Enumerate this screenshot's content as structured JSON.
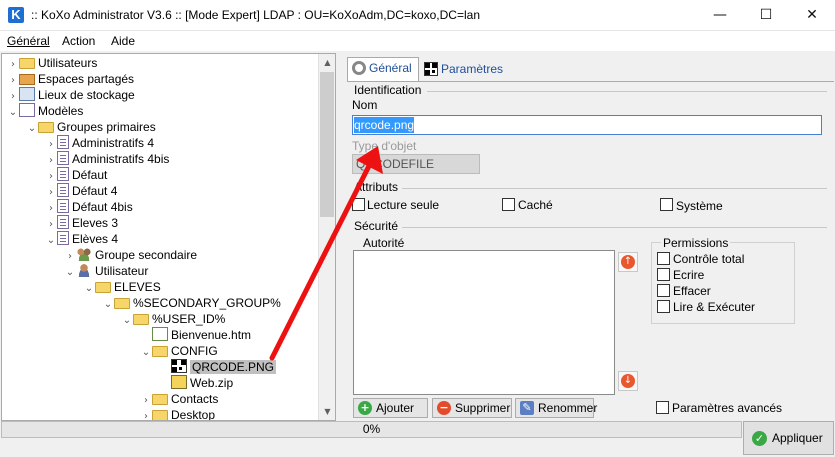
{
  "window": {
    "title": ":: KoXo Administrator V3.6 :: [Mode Expert] LDAP : OU=KoXoAdm,DC=koxo,DC=lan",
    "logo_letter": "K",
    "minimize": "—",
    "maximize": "☐",
    "close": "✕"
  },
  "menu": {
    "general": "Général",
    "action": "Action",
    "aide": "Aide"
  },
  "tree": {
    "items": [
      {
        "label": "Utilisateurs",
        "icon": "users-folder-icon"
      },
      {
        "label": "Espaces partagés",
        "icon": "shared-space-icon"
      },
      {
        "label": "Lieux de stockage",
        "icon": "storage-icon"
      },
      {
        "label": "Modèles",
        "icon": "models-icon"
      },
      {
        "label": "Groupes primaires",
        "icon": "folder-open-icon"
      },
      {
        "label": "Administratifs 4",
        "icon": "template-icon"
      },
      {
        "label": "Administratifs 4bis",
        "icon": "template-icon"
      },
      {
        "label": "Défaut",
        "icon": "template-icon"
      },
      {
        "label": "Défaut 4",
        "icon": "template-icon"
      },
      {
        "label": "Défaut 4bis",
        "icon": "template-icon"
      },
      {
        "label": "Eleves 3",
        "icon": "template-icon"
      },
      {
        "label": "Elèves 4",
        "icon": "template-icon"
      },
      {
        "label": "Groupe secondaire",
        "icon": "group-icon"
      },
      {
        "label": "Utilisateur",
        "icon": "user-icon"
      },
      {
        "label": "ELEVES",
        "icon": "folder-icon"
      },
      {
        "label": "%SECONDARY_GROUP%",
        "icon": "folder-icon"
      },
      {
        "label": "%USER_ID%",
        "icon": "folder-icon"
      },
      {
        "label": "Bienvenue.htm",
        "icon": "html-file-icon"
      },
      {
        "label": "CONFIG",
        "icon": "folder-icon"
      },
      {
        "label": "QRCODE.PNG",
        "icon": "qrcode-file-icon"
      },
      {
        "label": "Web.zip",
        "icon": "zip-file-icon"
      },
      {
        "label": "Contacts",
        "icon": "folder-icon"
      },
      {
        "label": "Desktop",
        "icon": "folder-icon"
      }
    ]
  },
  "tabs": {
    "general": "Général",
    "parametres": "Paramètres"
  },
  "general": {
    "identification": "Identification",
    "nom_label": "Nom",
    "nom_value": "qrcode.png",
    "type_label": "Type d'objet",
    "type_value": "QRCODEFILE",
    "attributs": "Attributs",
    "lecture_seule": "Lecture seule",
    "cache": "Caché",
    "systeme": "Système",
    "securite": "Sécurité",
    "autorite": "Autorité",
    "permissions": "Permissions",
    "controle_total": "Contrôle total",
    "ecrire": "Ecrire",
    "effacer": "Effacer",
    "lire_executer": "Lire & Exécuter",
    "parametres_avances": "Paramètres avancés",
    "ajouter": "Ajouter",
    "supprimer": "Supprimer",
    "renommer": "Renommer"
  },
  "status": {
    "progress_text": "0%",
    "progress": 0,
    "apply": "Appliquer"
  },
  "colors": {
    "annotation_arrow": "#ee1111",
    "selection": "#3399ff",
    "tab_active_text": "#1f4e99"
  }
}
